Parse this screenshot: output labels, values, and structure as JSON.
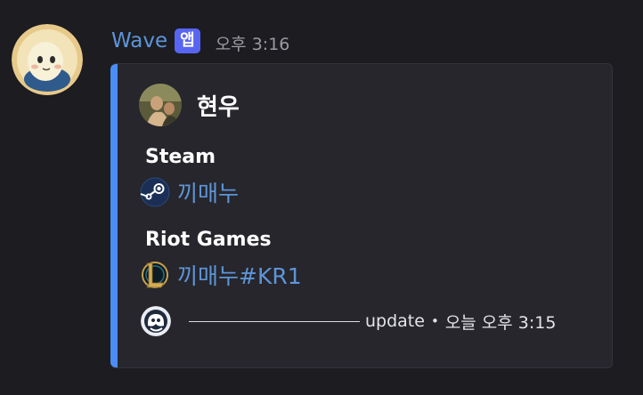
{
  "message": {
    "username": "Wave",
    "app_badge": "앱",
    "timestamp": "오후 3:16",
    "avatar_icon": "chick-bot-avatar-icon"
  },
  "embed": {
    "accent_color": "#4a8df6",
    "author": {
      "name": "현우",
      "icon": "profile-art-icon"
    },
    "fields": [
      {
        "name": "Steam",
        "icon": "steam-icon",
        "value": "끼매누"
      },
      {
        "name": "Riot Games",
        "icon": "league-of-legends-icon",
        "value": "끼매누#KR1"
      }
    ],
    "footer": {
      "icon": "wave-bot-icon",
      "text": "update",
      "separator": "•",
      "time": "오늘 오후 3:15"
    }
  },
  "colors": {
    "background": "#1c1c21",
    "embed_background": "#26262c",
    "username": "#5e95d8",
    "link": "#5e95d8",
    "badge": "#5865f2"
  }
}
